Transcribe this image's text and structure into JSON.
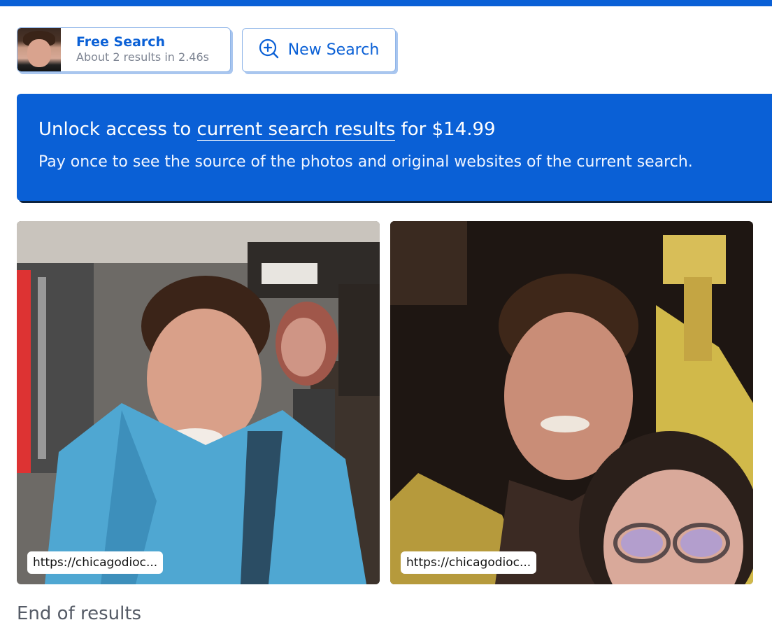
{
  "search_card": {
    "title": "Free Search",
    "subtitle": "About 2 results in 2.46s"
  },
  "new_search": {
    "label": "New Search",
    "icon": "zoom-in-icon"
  },
  "banner": {
    "title_prefix": "Unlock access to ",
    "title_link": "current search results",
    "title_suffix": " for $14.99",
    "subtitle": "Pay once to see the source of the photos and original websites of the current search."
  },
  "results": [
    {
      "url": "https://chicagodioc..."
    },
    {
      "url": "https://chicagodioc..."
    }
  ],
  "footer": {
    "end_text": "End of results"
  },
  "colors": {
    "accent": "#0a60d6",
    "banner_shadow": "#0c2340",
    "card_border": "#8fb5e8"
  }
}
